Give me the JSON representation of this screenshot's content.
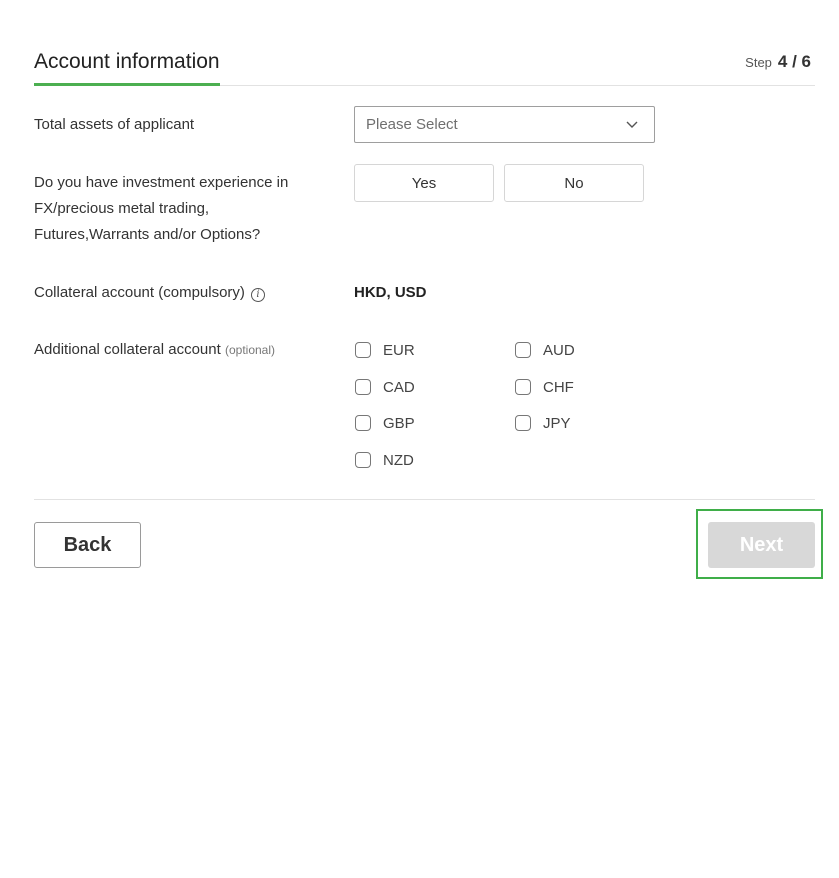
{
  "header": {
    "title": "Account information",
    "step_label": "Step",
    "step_value": "4 / 6"
  },
  "total_assets": {
    "label": "Total assets of applicant",
    "placeholder": "Please Select"
  },
  "investment_experience": {
    "label_line1": "Do you have investment experience in",
    "label_line2": "FX/precious metal trading,",
    "label_line3": "Futures,Warrants and/or Options?",
    "yes_label": "Yes",
    "no_label": "No"
  },
  "collateral": {
    "label": "Collateral account (compulsory)",
    "info_icon": "i",
    "value": "HKD, USD"
  },
  "additional_collateral": {
    "label": "Additional collateral account",
    "optional": "(optional)",
    "options": [
      "EUR",
      "AUD",
      "CAD",
      "CHF",
      "GBP",
      "JPY",
      "NZD"
    ]
  },
  "footer": {
    "back_label": "Back",
    "next_label": "Next"
  },
  "colors": {
    "accent": "#4caf50",
    "highlight": "#3fae49",
    "disabled": "#d8d8d8"
  }
}
